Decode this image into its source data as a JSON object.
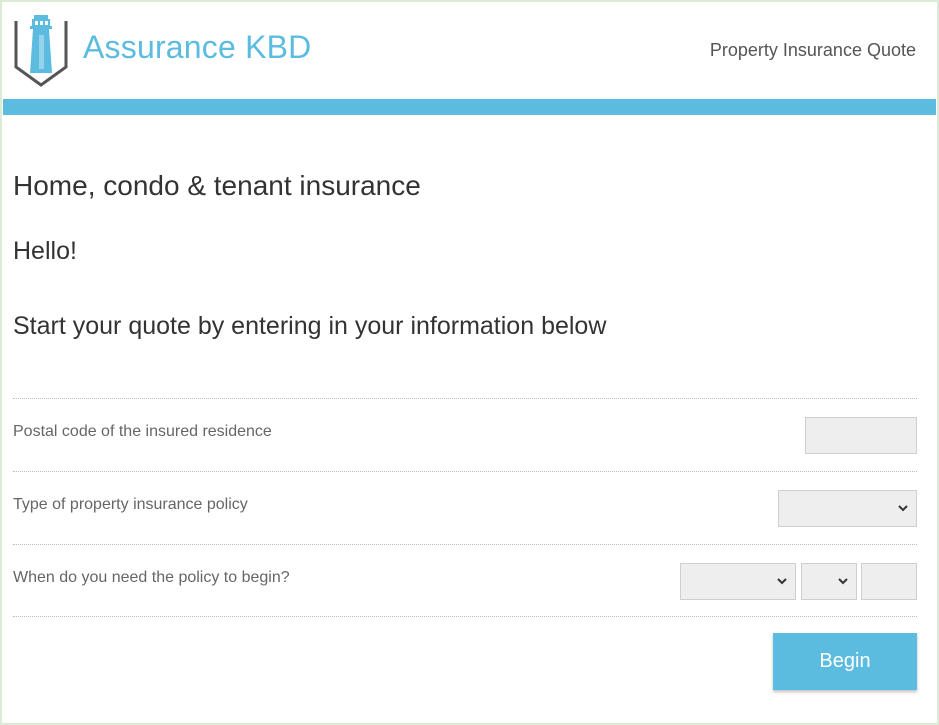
{
  "header": {
    "brand": "Assurance KBD",
    "right_title": "Property Insurance Quote"
  },
  "main": {
    "title": "Home, condo & tenant insurance",
    "greeting": "Hello!",
    "instruction": "Start your quote by entering in your information below"
  },
  "form": {
    "rows": [
      {
        "label": "Postal code of the insured residence",
        "value": ""
      },
      {
        "label": "Type of property insurance policy",
        "selected": ""
      },
      {
        "label": "When do you need the policy to begin?",
        "month": "",
        "day": "",
        "year": ""
      }
    ],
    "submit_label": "Begin"
  },
  "colors": {
    "accent": "#5bbcdf",
    "frame": "#dcebd6",
    "field_bg": "#eeeeee"
  },
  "icons": {
    "logo": "lighthouse-shield-icon",
    "dropdown": "chevron-down-icon"
  }
}
